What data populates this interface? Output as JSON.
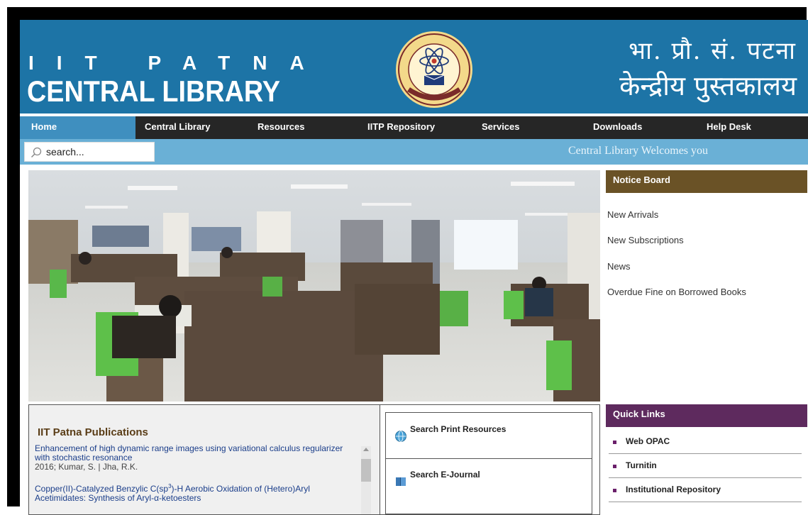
{
  "header": {
    "iit": "IIT PATNA",
    "title": "CENTRAL LIBRARY",
    "hindi_line1": "भा. प्रौ. सं. पटना",
    "hindi_line2": "केन्द्रीय पुस्तकालय"
  },
  "nav": {
    "items": [
      {
        "label": "Home"
      },
      {
        "label": "Central Library"
      },
      {
        "label": "Resources"
      },
      {
        "label": "IITP Repository"
      },
      {
        "label": "Services"
      },
      {
        "label": "Downloads"
      },
      {
        "label": "Help Desk"
      }
    ]
  },
  "search": {
    "placeholder": "search..."
  },
  "welcome": "Central Library Welcomes you",
  "notice_board": {
    "title": "Notice Board",
    "links": [
      "New Arrivals",
      "New Subscriptions",
      "News",
      "Overdue Fine on Borrowed Books"
    ]
  },
  "publications": {
    "title": "IIT Patna Publications",
    "items": [
      {
        "title": "Enhancement of high dynamic range images using variational calculus regularizer with stochastic resonance",
        "meta": "2016; Kumar, S. | Jha, R.K."
      },
      {
        "title_pre": "Copper(II)-Catalyzed Benzylic C(sp",
        "title_sup": "3",
        "title_post": ")-H Aerobic Oxidation of (Hetero)Aryl Acetimidates: Synthesis of Aryl-α-ketoesters"
      }
    ]
  },
  "search_resources": {
    "items": [
      "Search Print Resources",
      "Search E-Journal"
    ]
  },
  "quick_links": {
    "title": "Quick Links",
    "items": [
      "Web OPAC",
      "Turnitin",
      "Institutional Repository"
    ]
  },
  "colors": {
    "header_blue": "#1d74a6",
    "nav_dark": "#262626",
    "search_bar": "#6ab0d6",
    "notice_brown": "#6a5226",
    "quick_purple": "#5e2a5e"
  }
}
